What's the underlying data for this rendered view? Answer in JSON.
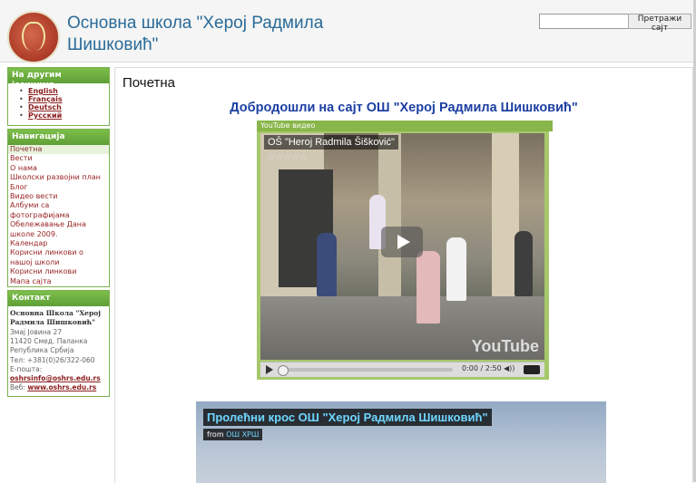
{
  "header": {
    "site_title": "Основна школа \"Херој Радмила Шишковић\"",
    "search_placeholder": "",
    "search_button": "Претражи сајт"
  },
  "sidebar": {
    "languages_title": "На другим језицима",
    "languages": [
      "English",
      "Français",
      "Deutsch",
      "Русский"
    ],
    "nav_title": "Навигација",
    "nav_items": [
      "Почетна",
      "Вести",
      "О нама",
      "Школски развојни план",
      "Блог",
      "Видео вести",
      "Албуми са фотографијама",
      "Обележавање Дана школе 2009.",
      "Календар",
      "Корисни линкови о нашој школи",
      "Корисни линкови",
      "Мапа сајта"
    ],
    "contact_title": "Контакт",
    "contact": {
      "school": "Основна Школа \"Херој Радмила Шишковић\"",
      "street": "Змај Јовина 27",
      "city": "11420 Смед. Паланка",
      "country": "Република Србија",
      "phone": "Тел: +381(0)26/322-060",
      "email_label": "Е-пошта:",
      "email": "oshrsinfo@oshrs.edu.rs",
      "web_label": "Веб:",
      "web": "www.oshrs.edu.rs"
    }
  },
  "main": {
    "page_title": "Почетна",
    "welcome": "Добродошли на сајт ОШ \"Херој Радмила Шишковић\"",
    "video1": {
      "header": "YouTube видео",
      "title": "OŠ \"Heroj Radmila Šišković\"",
      "stars": "☆☆☆☆☆",
      "brand": "YouTube",
      "time": "0:00 / 2:50",
      "volume": "◀))",
      "progress": 0
    },
    "video2": {
      "title": "Пролећни крос ОШ \"Херој Радмила Шишковић\"",
      "from_label": "from",
      "from_channel": "ОШ ХРШ"
    }
  },
  "colors": {
    "accent": "#2a6a98",
    "sidebar_green": "#6aa83f",
    "link_red": "#9a2424",
    "welcome_blue": "#1c3fa2"
  }
}
